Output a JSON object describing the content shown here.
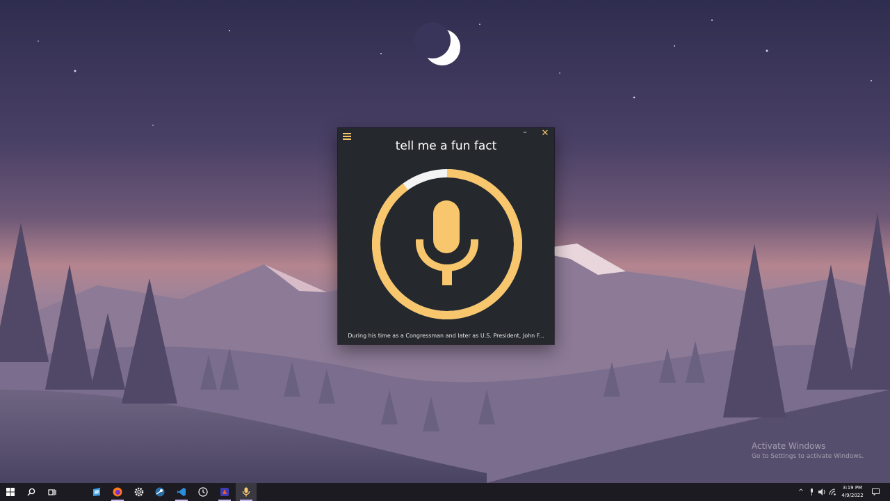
{
  "app": {
    "query": "tell me a fun fact",
    "response": "During his time as a Congressman and later as U.S. President, John F...",
    "accent_color": "#f7c66d",
    "progress": 0.9
  },
  "watermark": {
    "title": "Activate Windows",
    "subtitle": "Go to Settings to activate Windows."
  },
  "taskbar": {
    "apps": [
      "start-icon",
      "search-icon",
      "task-view-icon",
      "app-icon",
      "firefox-icon",
      "settings-icon",
      "steam-icon",
      "vscode-icon",
      "clock-app-icon",
      "app-icon",
      "assistant-icon"
    ],
    "clock_time": "3:19 PM",
    "clock_date": "4/9/2022"
  }
}
